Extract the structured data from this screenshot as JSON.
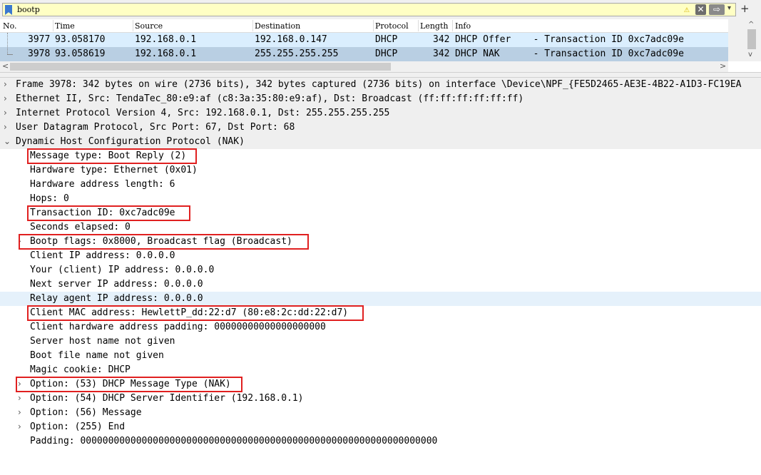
{
  "filter": {
    "value": "bootp"
  },
  "packet_list": {
    "columns": [
      "No.",
      "Time",
      "Source",
      "Destination",
      "Protocol",
      "Length",
      "Info"
    ],
    "rows": [
      {
        "no": "3977",
        "time": "93.058170",
        "source": "192.168.0.1",
        "destination": "192.168.0.147",
        "protocol": "DHCP",
        "length": "342",
        "info": "DHCP Offer    - Transaction ID 0xc7adc09e"
      },
      {
        "no": "3978",
        "time": "93.058619",
        "source": "192.168.0.1",
        "destination": "255.255.255.255",
        "protocol": "DHCP",
        "length": "342",
        "info": "DHCP NAK      - Transaction ID 0xc7adc09e"
      }
    ]
  },
  "details": [
    {
      "text": "Frame 3978: 342 bytes on wire (2736 bits), 342 bytes captured (2736 bits) on interface \\Device\\NPF_{FE5D2465-AE3E-4B22-A1D3-FC19EA",
      "arrow": "›"
    },
    {
      "text": "Ethernet II, Src: TendaTec_80:e9:af (c8:3a:35:80:e9:af), Dst: Broadcast (ff:ff:ff:ff:ff:ff)",
      "arrow": "›"
    },
    {
      "text": "Internet Protocol Version 4, Src: 192.168.0.1, Dst: 255.255.255.255",
      "arrow": "›"
    },
    {
      "text": "User Datagram Protocol, Src Port: 67, Dst Port: 68",
      "arrow": "›"
    },
    {
      "text": "Dynamic Host Configuration Protocol (NAK)",
      "arrow": "⌄"
    },
    {
      "text": "Message type: Boot Reply (2)",
      "arrow": ""
    },
    {
      "text": "Hardware type: Ethernet (0x01)",
      "arrow": ""
    },
    {
      "text": "Hardware address length: 6",
      "arrow": ""
    },
    {
      "text": "Hops: 0",
      "arrow": ""
    },
    {
      "text": "Transaction ID: 0xc7adc09e",
      "arrow": ""
    },
    {
      "text": "Seconds elapsed: 0",
      "arrow": ""
    },
    {
      "text": "Bootp flags: 0x8000, Broadcast flag (Broadcast)",
      "arrow": "›"
    },
    {
      "text": "Client IP address: 0.0.0.0",
      "arrow": ""
    },
    {
      "text": "Your (client) IP address: 0.0.0.0",
      "arrow": ""
    },
    {
      "text": "Next server IP address: 0.0.0.0",
      "arrow": ""
    },
    {
      "text": "Relay agent IP address: 0.0.0.0",
      "arrow": ""
    },
    {
      "text": "Client MAC address: HewlettP_dd:22:d7 (80:e8:2c:dd:22:d7)",
      "arrow": ""
    },
    {
      "text": "Client hardware address padding: 00000000000000000000",
      "arrow": ""
    },
    {
      "text": "Server host name not given",
      "arrow": ""
    },
    {
      "text": "Boot file name not given",
      "arrow": ""
    },
    {
      "text": "Magic cookie: DHCP",
      "arrow": ""
    },
    {
      "text": "Option: (53) DHCP Message Type (NAK)",
      "arrow": "›"
    },
    {
      "text": "Option: (54) DHCP Server Identifier (192.168.0.1)",
      "arrow": "›"
    },
    {
      "text": "Option: (56) Message",
      "arrow": "›"
    },
    {
      "text": "Option: (255) End",
      "arrow": "›"
    },
    {
      "text": "Padding: 0000000000000000000000000000000000000000000000000000000000000000",
      "arrow": ""
    }
  ],
  "icons": {
    "bookmark": "bookmark-icon",
    "warning": "⚠",
    "clear": "✕",
    "apply": "⇨",
    "dropdown": "▾",
    "add": "+",
    "scroll_left": "<",
    "scroll_right": ">",
    "scroll_up": "^",
    "scroll_down": "v"
  },
  "colors": {
    "filter_bg": "#ffffc4",
    "row_selected": "#b9cfe3",
    "row_other": "#daeefe",
    "highlight_box": "#e02020"
  }
}
